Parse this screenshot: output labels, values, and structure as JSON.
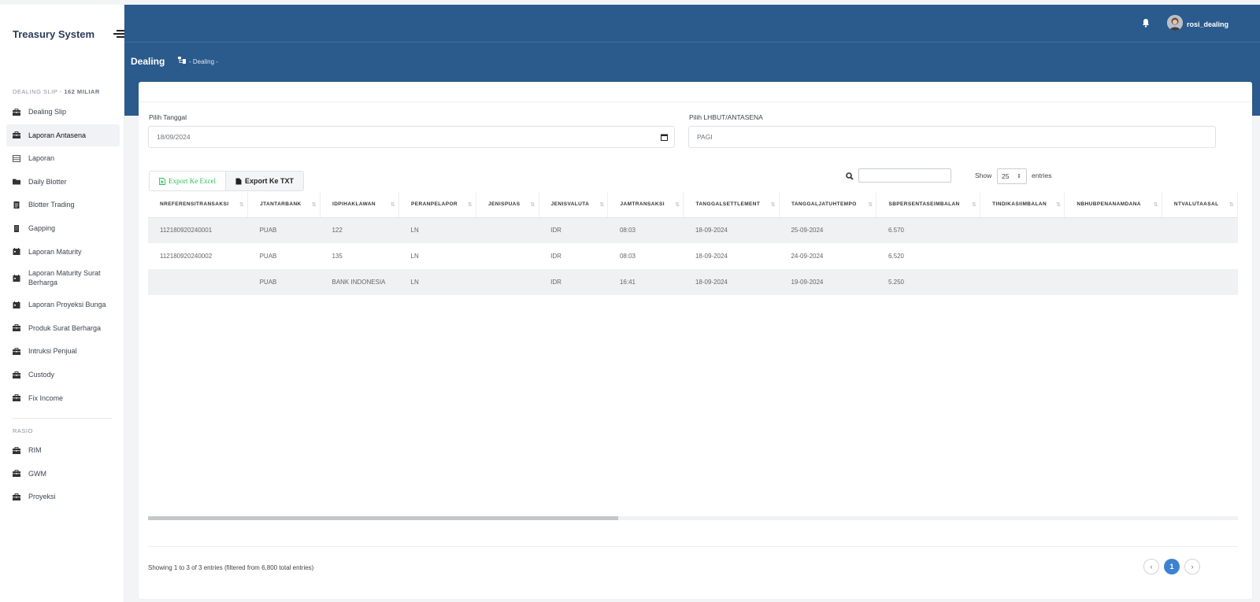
{
  "sidebar": {
    "brand": "Treasury System",
    "section1": {
      "prefix": "DEALING SLIP - ",
      "highlight": "162 MILIAR"
    },
    "items": [
      {
        "label": "Dealing Slip",
        "icon": "briefcase-icon"
      },
      {
        "label": "Laporan Antasena",
        "icon": "briefcase-icon",
        "active": true
      },
      {
        "label": "Laporan",
        "icon": "table-icon"
      },
      {
        "label": "Daily Blotter",
        "icon": "folder-icon"
      },
      {
        "label": "Blotter Trading",
        "icon": "document-icon"
      },
      {
        "label": "Gapping",
        "icon": "building-icon"
      },
      {
        "label": "Laporan Maturity",
        "icon": "calendar-icon"
      },
      {
        "label": "Laporan Maturity Surat Berharga",
        "icon": "calendar-icon"
      },
      {
        "label": "Laporan Proyeksi Bunga",
        "icon": "calendar-icon"
      },
      {
        "label": "Produk Surat Berharga",
        "icon": "briefcase-icon"
      },
      {
        "label": "Intruksi Penjual",
        "icon": "briefcase-icon"
      },
      {
        "label": "Custody",
        "icon": "briefcase-icon"
      },
      {
        "label": "Fix Income",
        "icon": "briefcase-icon"
      }
    ],
    "section2": "RASIO",
    "items2": [
      {
        "label": "RIM",
        "icon": "briefcase-icon"
      },
      {
        "label": "GWM",
        "icon": "briefcase-icon"
      },
      {
        "label": "Proyeksi",
        "icon": "briefcase-icon"
      }
    ]
  },
  "header": {
    "username": "rosi_dealing",
    "page_title": "Dealing",
    "breadcrumb": "- Dealing -"
  },
  "filters": {
    "date_label": "Pilih Tanggal",
    "date_value": "18/09/2024",
    "lhbut_label": "Pilih LHBUT/ANTASENA",
    "lhbut_value": "PAGI"
  },
  "toolbar": {
    "export_excel": "Export Ke Excel",
    "export_txt": "Export Ke TXT",
    "show_label": "Show",
    "page_size": "25",
    "entries_label": "entries"
  },
  "table": {
    "columns": [
      "NREFERENSITRANSAKSI",
      "JTANTARBANK",
      "IDPIHAKLAWAN",
      "PERANPELAPOR",
      "JENISPUAS",
      "JENISVALUTA",
      "JAMTRANSAKSI",
      "TANGGALSETTLEMENT",
      "TANGGALJATUHTEMPO",
      "SBPERSENTASEIMBALAN",
      "TINDIKASIIMBALAN",
      "NBHUBPENANAMDANA",
      "NTVALUTAASAL"
    ],
    "rows": [
      [
        "112180920240001",
        "PUAB",
        "122",
        "LN",
        "",
        "IDR",
        "08:03",
        "18-09-2024",
        "25-09-2024",
        "6.570",
        "",
        "",
        ""
      ],
      [
        "112180920240002",
        "PUAB",
        "135",
        "LN",
        "",
        "IDR",
        "08:03",
        "18-09-2024",
        "24-09-2024",
        "6.520",
        "",
        "",
        ""
      ],
      [
        "",
        "PUAB",
        "BANK INDONESIA",
        "LN",
        "",
        "IDR",
        "16:41",
        "18-09-2024",
        "19-09-2024",
        "5.250",
        "",
        "",
        ""
      ]
    ]
  },
  "footer": {
    "showing": "Showing 1 to 3 of 3 entries (filtered from 6,800 total entries)",
    "prev": "‹",
    "current_page": "1",
    "next": "›"
  },
  "colors": {
    "header_bg": "#2b5a8c",
    "accent": "#3d82d1",
    "excel_green": "#2bbf5c"
  }
}
